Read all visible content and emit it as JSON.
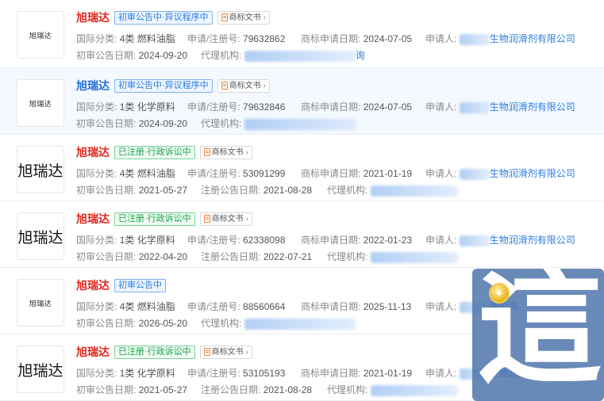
{
  "rows": [
    {
      "thumb_text": "旭瑞达",
      "thumb_size": "small",
      "name": "旭瑞达",
      "tags": [
        {
          "text": "初审公告中·异议程序中",
          "color": "blue"
        }
      ],
      "doc_button": "商标文书",
      "class_label": "国际分类:",
      "class_value": "4类 燃料油脂",
      "reg_label": "申请/注册号:",
      "reg_value": "79632862",
      "date_label": "商标申请日期:",
      "date_value": "2024-07-05",
      "applicant_label": "申请人:",
      "applicant_value": "生物润滑剂有限公司",
      "pub_label": "初审公告日期:",
      "pub_value": "2024-09-20",
      "agent_label": "代理机构:",
      "agent_value": "询"
    },
    {
      "thumb_text": "旭瑞达",
      "thumb_size": "small",
      "name": "旭瑞达",
      "tags": [
        {
          "text": "初审公告中·异议程序中",
          "color": "blue"
        }
      ],
      "doc_button": "商标文书",
      "class_label": "国际分类:",
      "class_value": "1类 化学原料",
      "reg_label": "申请/注册号:",
      "reg_value": "79632846",
      "date_label": "商标申请日期:",
      "date_value": "2024-07-05",
      "applicant_label": "申请人:",
      "applicant_value": "生物润滑剂有限公司",
      "pub_label": "初审公告日期:",
      "pub_value": "2024-09-20",
      "agent_label": "代理机构:",
      "agent_value": ""
    },
    {
      "thumb_text": "旭瑞达",
      "thumb_size": "large",
      "name": "旭瑞达",
      "tags": [
        {
          "text": "已注册·行政诉讼中",
          "color": "green"
        }
      ],
      "doc_button": "商标文书",
      "class_label": "国际分类:",
      "class_value": "4类 燃料油脂",
      "reg_label": "申请/注册号:",
      "reg_value": "53091299",
      "date_label": "商标申请日期:",
      "date_value": "2021-01-19",
      "applicant_label": "申请人:",
      "applicant_value": "生物润滑剂有限公司",
      "pub_label": "初审公告日期:",
      "pub_value": "2021-05-27",
      "regpub_label": "注册公告日期:",
      "regpub_value": "2021-08-28",
      "agent_label": "代理机构:",
      "agent_value": ""
    },
    {
      "thumb_text": "旭瑞达",
      "thumb_size": "large",
      "name": "旭瑞达",
      "tags": [
        {
          "text": "已注册·行政诉讼中",
          "color": "green"
        }
      ],
      "doc_button": "商标文书",
      "class_label": "国际分类:",
      "class_value": "1类 化学原料",
      "reg_label": "申请/注册号:",
      "reg_value": "62338098",
      "date_label": "商标申请日期:",
      "date_value": "2022-01-23",
      "applicant_label": "申请人:",
      "applicant_value": "生物润滑剂有限公司",
      "pub_label": "初审公告日期:",
      "pub_value": "2022-04-20",
      "regpub_label": "注册公告日期:",
      "regpub_value": "2022-07-21",
      "agent_label": "代理机构:",
      "agent_value": ""
    },
    {
      "thumb_text": "旭瑞达",
      "thumb_size": "small",
      "name": "旭瑞达",
      "tags": [
        {
          "text": "初审公告中",
          "color": "blue"
        }
      ],
      "doc_button": "",
      "class_label": "国际分类:",
      "class_value": "4类 燃料油脂",
      "reg_label": "申请/注册号:",
      "reg_value": "88560664",
      "date_label": "商标申请日期:",
      "date_value": "2025-11-13",
      "applicant_label": "申请人:",
      "applicant_value": "限公司",
      "pub_label": "初审公告日期:",
      "pub_value": "2026-05-20",
      "agent_label": "代理机构:",
      "agent_value": ""
    },
    {
      "thumb_text": "旭瑞达",
      "thumb_size": "large",
      "name": "旭瑞达",
      "tags": [
        {
          "text": "已注册·行政诉讼中",
          "color": "green"
        }
      ],
      "doc_button": "商标文书",
      "class_label": "国际分类:",
      "class_value": "1类 化学原料",
      "reg_label": "申请/注册号:",
      "reg_value": "53105193",
      "date_label": "商标申请日期:",
      "date_value": "2021-01-19",
      "applicant_label": "申请人:",
      "applicant_value": "生物润滑剂有限公司",
      "pub_label": "初审公告日期:",
      "pub_value": "2021-05-27",
      "regpub_label": "注册公告日期:",
      "regpub_value": "2021-08-28",
      "agent_label": "代理机构:",
      "agent_value": ""
    }
  ],
  "watermark": {
    "glyph": "這",
    "badge_icon": "sparkle-icon"
  },
  "colors": {
    "brand_red": "#e1251b",
    "link_blue": "#2a7de1",
    "tag_green": "#17a34a"
  }
}
